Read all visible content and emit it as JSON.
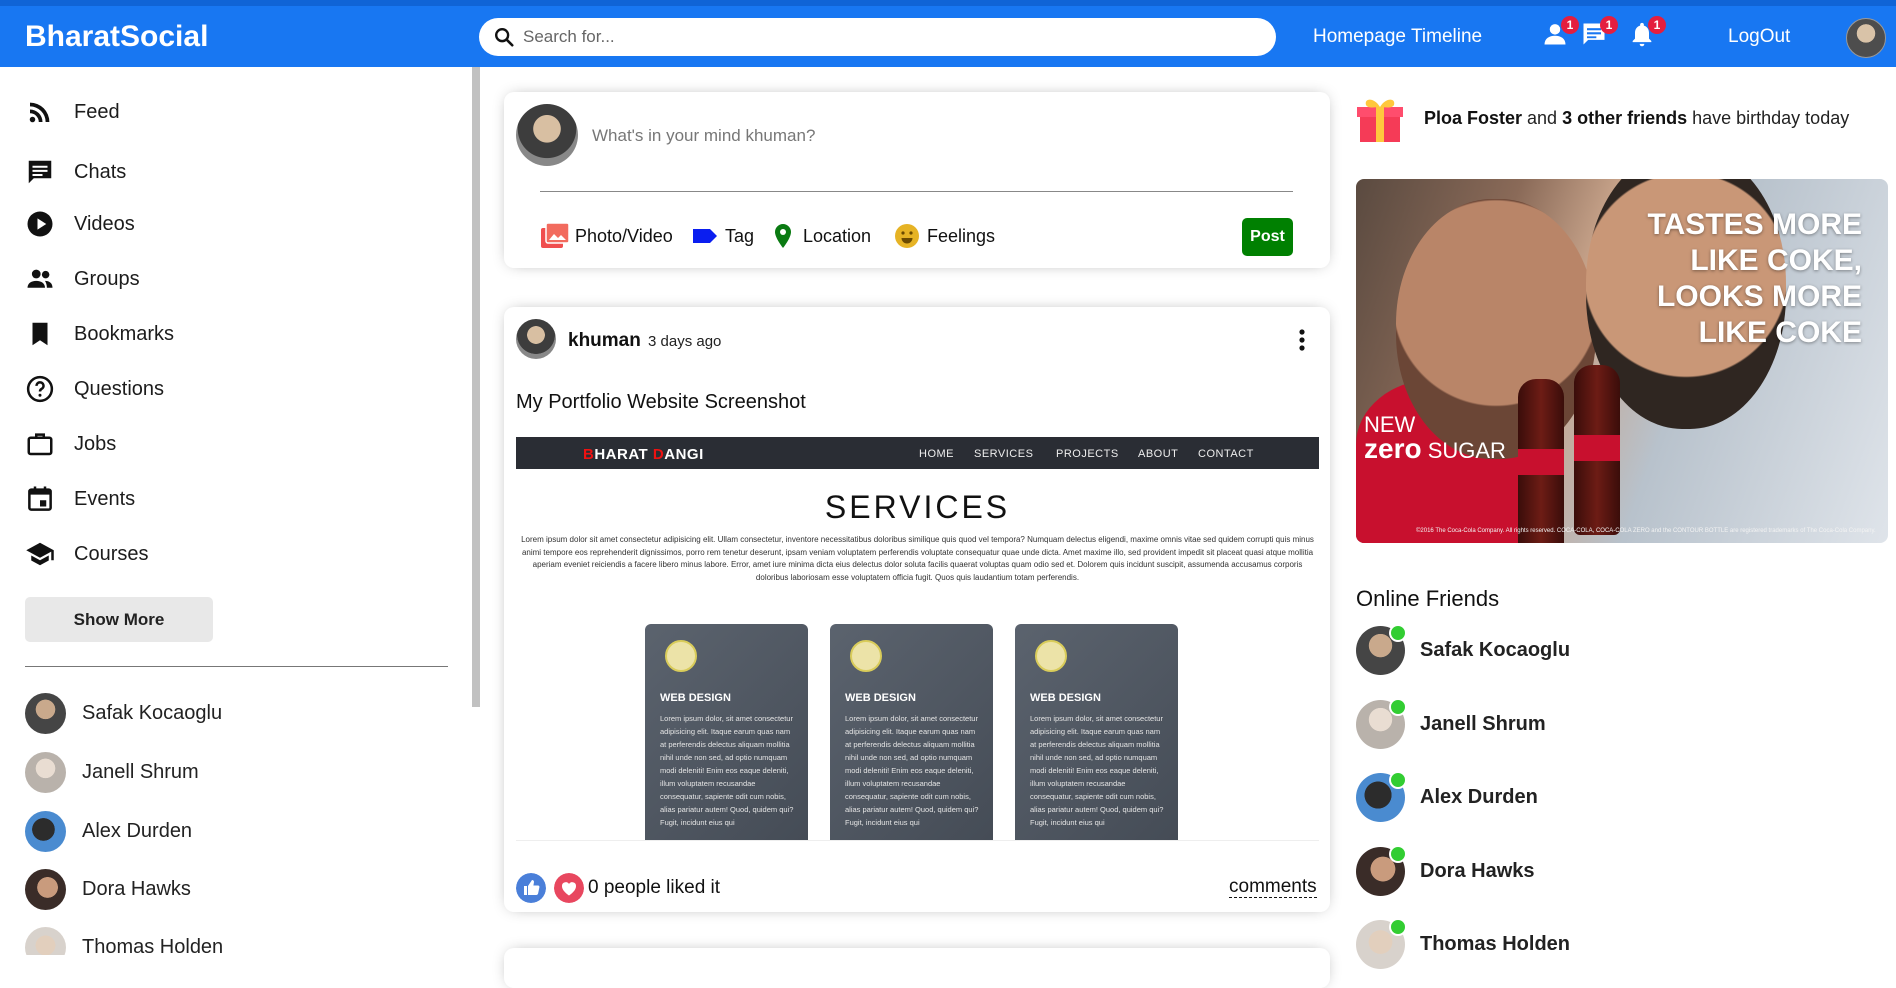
{
  "brand": "BharatSocial",
  "search": {
    "placeholder": "Search for..."
  },
  "topbar": {
    "links": [
      "Homepage",
      "Timeline"
    ],
    "badges": {
      "friend_requests": "1",
      "messages": "1",
      "notifications": "1"
    },
    "logout": "LogOut"
  },
  "sidebar": {
    "items": [
      {
        "label": "Feed",
        "icon": "rss-feed-icon"
      },
      {
        "label": "Chats",
        "icon": "chat-icon"
      },
      {
        "label": "Videos",
        "icon": "play-circle-icon"
      },
      {
        "label": "Groups",
        "icon": "group-icon"
      },
      {
        "label": "Bookmarks",
        "icon": "bookmark-icon"
      },
      {
        "label": "Questions",
        "icon": "help-circle-icon"
      },
      {
        "label": "Jobs",
        "icon": "work-icon"
      },
      {
        "label": "Events",
        "icon": "calendar-icon"
      },
      {
        "label": "Courses",
        "icon": "school-icon"
      }
    ],
    "show_more": "Show More",
    "friends": [
      "Safak Kocaoglu",
      "Janell Shrum",
      "Alex Durden",
      "Dora Hawks",
      "Thomas Holden"
    ]
  },
  "share": {
    "placeholder": "What's in your mind khuman?",
    "options": [
      "Photo/Video",
      "Tag",
      "Location",
      "Feelings"
    ],
    "post_button": "Post"
  },
  "post": {
    "username": "khuman",
    "date": "3 days ago",
    "text": "My Portfolio Website Screenshot",
    "screenshot": {
      "brand_first": "B",
      "brand_mid": "HARAT ",
      "brand_d": "D",
      "brand_last": "ANGI",
      "menu": [
        "HOME",
        "SERVICES",
        "PROJECTS",
        "ABOUT",
        "CONTACT"
      ],
      "title": "SERVICES",
      "paragraph": "Lorem ipsum dolor sit amet consectetur adipisicing elit. Ullam consectetur, inventore necessitatibus doloribus similique quis quod vel tempora? Numquam delectus eligendi, maxime omnis vitae sed quidem corrupti quis minus animi tempore eos reprehenderit dignissimos, porro rem tenetur deserunt, ipsam veniam voluptatem perferendis voluptate consequatur quae unde dicta. Amet maxime illo, sed provident impedit sit placeat quasi atque mollitia aperiam eveniet reiciendis a facere libero minus labore. Error, amet iure minima dicta eius delectus dolor soluta facilis quaerat voluptas quam odio sed et. Dolorem quis incidunt suscipit, assumenda accusamus corporis doloribus laboriosam esse voluptatem officia fugit. Quos quis laudantium totam perferendis.",
      "cards": [
        {
          "title": "WEB DESIGN",
          "text": "Lorem ipsum dolor, sit amet consectetur adipisicing elit. Itaque earum quas nam at perferendis delectus aliquam mollitia nihil unde non sed, ad optio numquam modi deleniti! Enim eos eaque deleniti, illum voluptatem recusandae consequatur, sapiente odit cum nobis, alias pariatur autem! Quod, quidem qui? Fugit, incidunt eius qui"
        },
        {
          "title": "WEB DESIGN",
          "text": "Lorem ipsum dolor, sit amet consectetur adipisicing elit. Itaque earum quas nam at perferendis delectus aliquam mollitia nihil unde non sed, ad optio numquam modi deleniti! Enim eos eaque deleniti, illum voluptatem recusandae consequatur, sapiente odit cum nobis, alias pariatur autem! Quod, quidem qui? Fugit, incidunt eius qui"
        },
        {
          "title": "WEB DESIGN",
          "text": "Lorem ipsum dolor, sit amet consectetur adipisicing elit. Itaque earum quas nam at perferendis delectus aliquam mollitia nihil unde non sed, ad optio numquam modi deleniti! Enim eos eaque deleniti, illum voluptatem recusandae consequatur, sapiente odit cum nobis, alias pariatur autem! Quod, quidem qui? Fugit, incidunt eius qui"
        }
      ]
    },
    "likes": "0 people liked it",
    "comments": "comments"
  },
  "birthday": {
    "name": "Ploa Foster",
    "middle": " and ",
    "others": "3 other friends",
    "suffix": " have birthday today"
  },
  "ad": {
    "slogan_lines": [
      "TASTES MORE",
      "LIKE COKE,",
      "LOOKS MORE",
      "LIKE COKE"
    ],
    "new": "NEW",
    "zero": "zero",
    "sugar": " SUGAR",
    "legal": "©2016 The Coca-Cola Company. All rights reserved. COCA-COLA, COCA-COLA ZERO and the CONTOUR BOTTLE are registered trademarks of The Coca-Cola Company."
  },
  "online": {
    "title": "Online Friends",
    "friends": [
      "Safak Kocaoglu",
      "Janell Shrum",
      "Alex Durden",
      "Dora Hawks",
      "Thomas Holden"
    ]
  },
  "colors": {
    "primary": "#1877f2",
    "badge": "#e41e3f",
    "post_button": "#008001",
    "online": "#32cd32"
  }
}
